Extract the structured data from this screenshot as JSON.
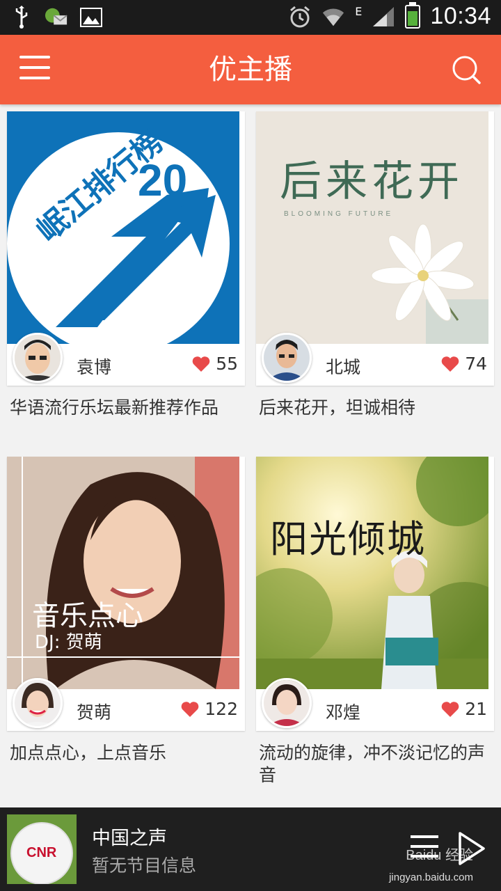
{
  "status_bar": {
    "time": "10:34",
    "network": "E"
  },
  "app_bar": {
    "title": "优主播"
  },
  "cards": [
    {
      "cover_title": "岷江排行榜",
      "cover_number": "20",
      "host": "袁博",
      "likes": "55",
      "description": "华语流行乐坛最新推荐作品"
    },
    {
      "cover_title": "后来花开",
      "cover_subtitle": "BLOOMING FUTURE",
      "host": "北城",
      "likes": "74",
      "description": "后来花开，坦诚相待"
    },
    {
      "cover_title": "音乐点心",
      "cover_subtitle": "DJ: 贺萌",
      "host": "贺萌",
      "likes": "122",
      "description": "加点点心，上点音乐"
    },
    {
      "cover_title": "阳光倾城",
      "host": "邓煌",
      "likes": "21",
      "description": "流动的旋律，冲不淡记忆的声音"
    }
  ],
  "player": {
    "logo_text": "CNR",
    "title": "中国之声",
    "subtitle": "暂无节目信息",
    "watermark": "Baidu 经验",
    "watermark_url": "jingyan.baidu.com"
  },
  "colors": {
    "accent": "#f45e3f",
    "heart": "#e84a4a",
    "player_bg": "#1f1f1f"
  }
}
